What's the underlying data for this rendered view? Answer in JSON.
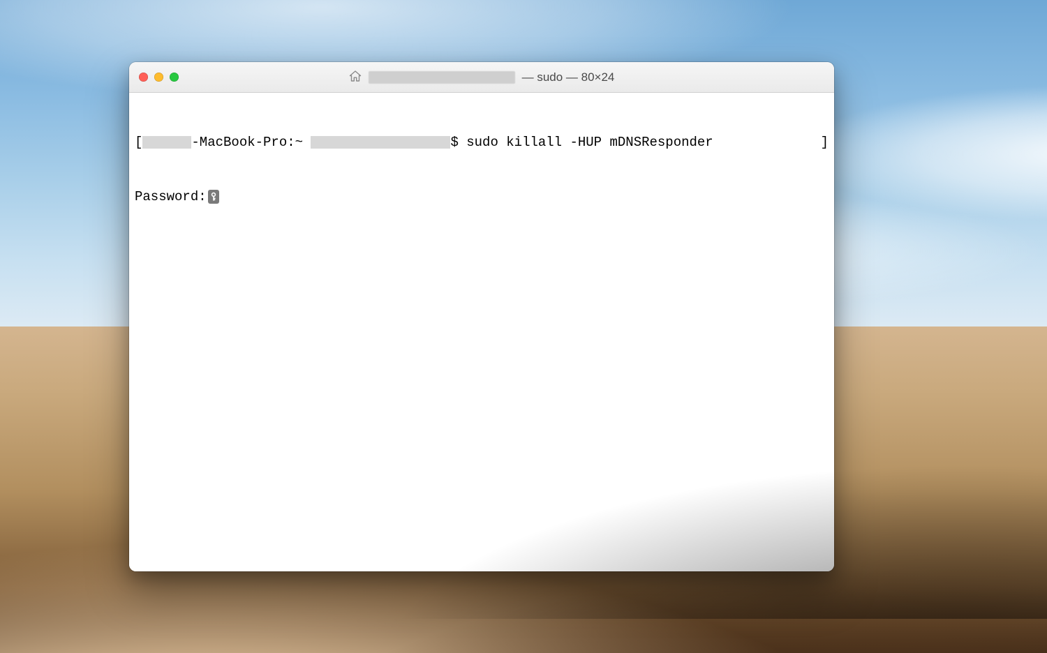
{
  "window": {
    "title_suffix": " — sudo — 80×24",
    "traffic_light_colors": {
      "close": "#ff5f57",
      "minimize": "#febc2e",
      "zoom": "#28c840"
    }
  },
  "terminal": {
    "line1": {
      "bracket_open": "[",
      "host_suffix": "-MacBook-Pro:~ ",
      "prompt_symbol": "$ ",
      "command": "sudo killall -HUP mDNSResponder",
      "bracket_close": "]"
    },
    "line2": {
      "label": "Password:"
    }
  }
}
